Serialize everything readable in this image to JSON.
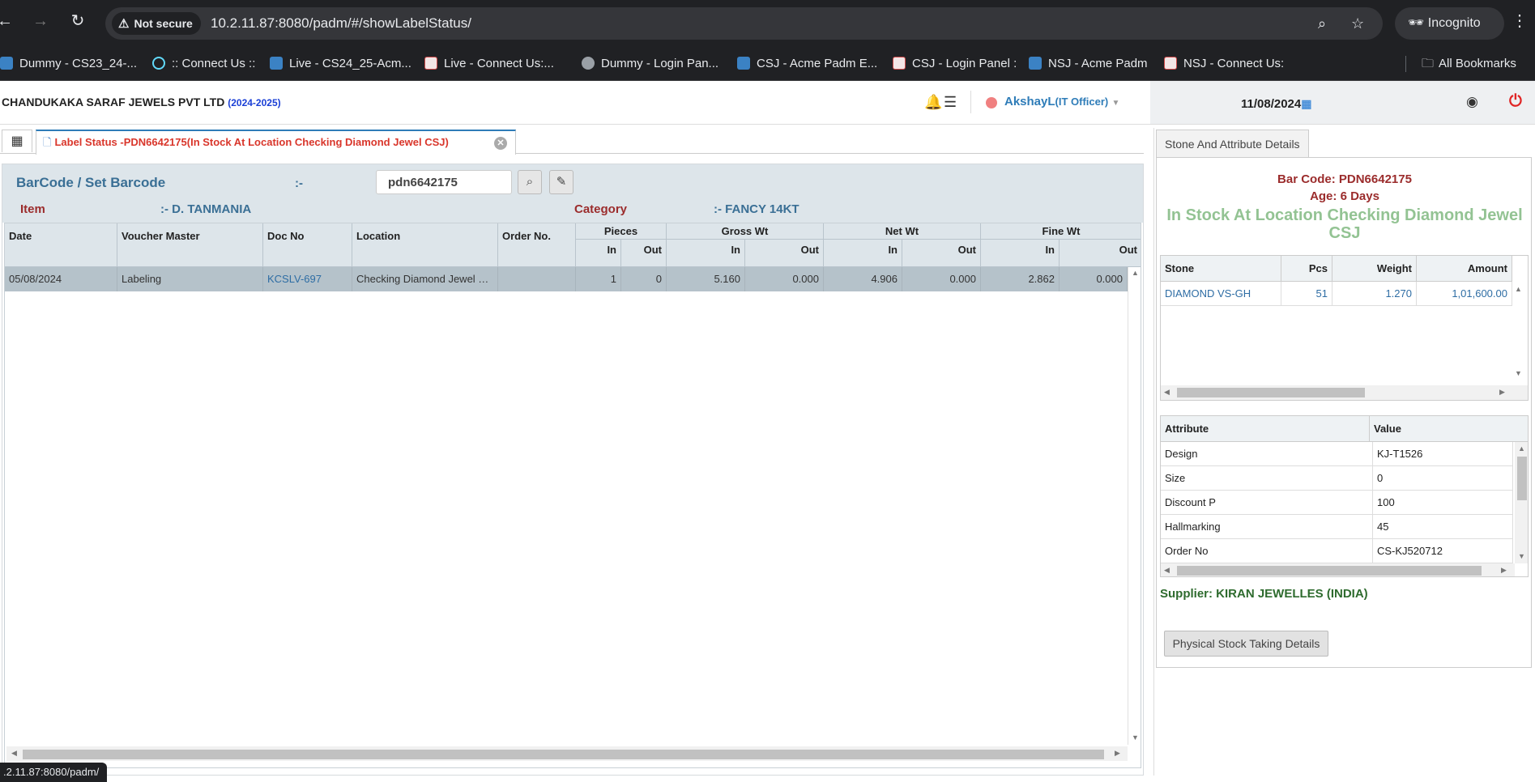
{
  "browser": {
    "security_label": "Not secure",
    "url": "10.2.11.87:8080/padm/#/showLabelStatus/",
    "profile_label": "Incognito",
    "status_url": ".2.11.87:8080/padm/",
    "bookmarks": [
      "Dummy  - CS23_24-...",
      ":: Connect Us ::",
      "Live - CS24_25-Acm...",
      "Live - Connect Us:...",
      "Dummy - Login Pan...",
      "CSJ - Acme Padm E...",
      "CSJ - Login Panel :",
      "NSJ - Acme Padm",
      "NSJ - Connect Us:"
    ],
    "all_bookmarks_label": "All Bookmarks"
  },
  "header": {
    "company": "CHANDUKAKA SARAF JEWELS PVT LTD",
    "year": "(2024-2025)",
    "user": "AkshayL",
    "role": "(IT Officer)",
    "date": "11/08/2024"
  },
  "tab": {
    "label": "Label Status -PDN6642175(In Stock At Location Checking Diamond Jewel CSJ)"
  },
  "filter": {
    "barcode_label": "BarCode / Set Barcode",
    "separator": ":-",
    "barcode_value": "pdn6642175",
    "item_label": "Item",
    "item_value": ":- D. TANMANIA",
    "category_label": "Category",
    "category_value": ":- FANCY 14KT"
  },
  "grid": {
    "headers": {
      "date": "Date",
      "voucher_master": "Voucher Master",
      "doc_no": "Doc No",
      "location": "Location",
      "order_no": "Order No.",
      "pieces": "Pieces",
      "gross_wt": "Gross Wt",
      "net_wt": "Net Wt",
      "fine_wt": "Fine Wt",
      "in": "In",
      "out": "Out"
    },
    "rows": [
      {
        "date": "05/08/2024",
        "voucher_master": "Labeling",
        "doc_no": "KCSLV-697",
        "location": "Checking Diamond Jewel CSJ",
        "order_no": "",
        "pieces_in": "1",
        "pieces_out": "0",
        "gross_in": "5.160",
        "gross_out": "0.000",
        "net_in": "4.906",
        "net_out": "0.000",
        "fine_in": "2.862",
        "fine_out": "0.000"
      }
    ]
  },
  "details": {
    "tab_label": "Stone And Attribute Details",
    "bar_code": "Bar Code: PDN6642175",
    "age": "Age: 6 Days",
    "stock_status": "In Stock At Location Checking Diamond Jewel CSJ",
    "stone_headers": {
      "stone": "Stone",
      "pcs": "Pcs",
      "weight": "Weight",
      "amount": "Amount"
    },
    "stones": [
      {
        "stone": "DIAMOND VS-GH",
        "pcs": "51",
        "weight": "1.270",
        "amount": "1,01,600.00"
      }
    ],
    "attr_headers": {
      "attribute": "Attribute",
      "value": "Value"
    },
    "attributes": [
      {
        "attribute": "Design",
        "value": "KJ-T1526"
      },
      {
        "attribute": "Size",
        "value": "0"
      },
      {
        "attribute": "Discount P",
        "value": "100"
      },
      {
        "attribute": "Hallmarking",
        "value": "45"
      },
      {
        "attribute": "Order No",
        "value": "CS-KJ520712"
      }
    ],
    "supplier": "Supplier: KIRAN JEWELLES (INDIA)",
    "physical_stock_button": "Physical Stock Taking Details"
  }
}
